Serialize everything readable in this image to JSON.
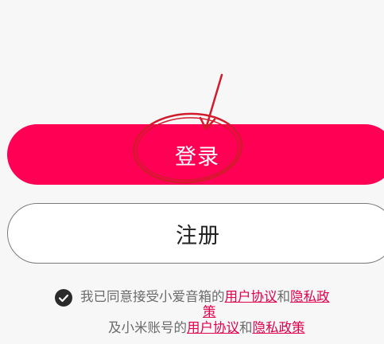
{
  "buttons": {
    "login_label": "登录",
    "register_label": "注册"
  },
  "agreement": {
    "prefix": "我已同意接受小爱音箱的",
    "user_agreement_1": "用户协议",
    "and_1": "和",
    "privacy_policy_1_part1": "隐私政",
    "privacy_policy_1_part2": "策",
    "prefix_2": "及小米账号的",
    "user_agreement_2": "用户协议",
    "and_2": "和",
    "privacy_policy_2": "隐私政策"
  },
  "colors": {
    "accent": "#ff0055",
    "link": "#e0004d",
    "annotation": "#d11a2a",
    "background": "#f7f7f7"
  },
  "icons": {
    "agree_check": "check-circle-icon"
  }
}
